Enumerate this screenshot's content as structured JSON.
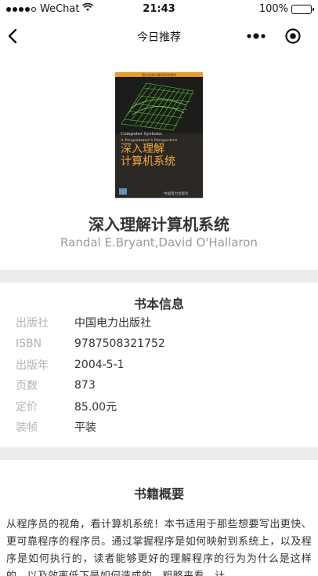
{
  "status_bar": {
    "carrier": "WeChat",
    "time": "21:43",
    "battery": "100%",
    "battery_level": 1.0
  },
  "nav": {
    "title": "今日推荐"
  },
  "book": {
    "title": "深入理解计算机系统",
    "author": "Randal E.Bryant,David O'Hallaron",
    "cover": {
      "series_text": "国外经典计算机科学教材",
      "en_title": "Computer Systems",
      "en_subtitle": "A Programmer's Perspective",
      "cn_title_line1": "深入理解",
      "cn_title_line2": "计算机系统",
      "publisher": "中国电力出版社"
    }
  },
  "info": {
    "heading": "书本信息",
    "rows": [
      {
        "label": "出版社",
        "value": "中国电力出版社"
      },
      {
        "label": "ISBN",
        "value": "9787508321752"
      },
      {
        "label": "出版年",
        "value": "2004-5-1"
      },
      {
        "label": "页数",
        "value": "873"
      },
      {
        "label": "定价",
        "value": "85.00元"
      },
      {
        "label": "装帧",
        "value": "平装"
      }
    ]
  },
  "summary": {
    "heading": "书籍概要",
    "text": "从程序员的视角，看计算机系统！本书适用于那些想要写出更快、更可靠程序的程序员。通过掌握程序是如何映射到系统上，以及程序是如何执行的，读者能够更好的理解程序的行为为什么是这样的，以及效率低下是如何造成的。粗略来看，计"
  },
  "colors": {
    "divider": "#ececec",
    "label_gray": "#b3b3b3",
    "author_gray": "#999999",
    "cover_accent": "#f5a93a"
  }
}
